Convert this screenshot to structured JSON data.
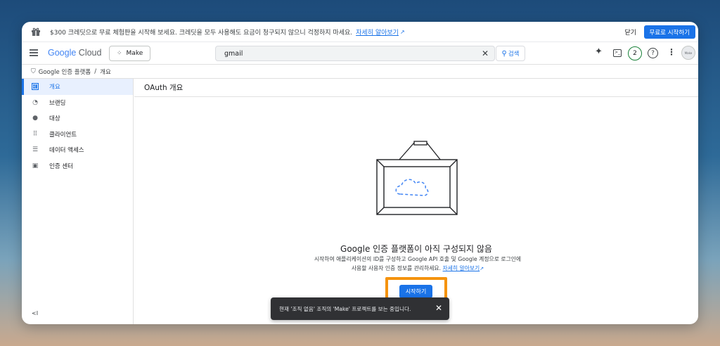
{
  "promo": {
    "text": "$300 크레딧으로 무료 체험판을 시작해 보세요. 크레딧을 모두 사용해도 요금이 청구되지 않으니 걱정하지 마세요.",
    "link": "자세히 알아보기",
    "close": "닫기",
    "trial_button": "무료로 시작하기"
  },
  "header": {
    "logo_google": "Google",
    "logo_cloud": "Cloud",
    "project": "Make",
    "search_value": "gmail",
    "search_button": "검색",
    "notification_count": "2",
    "avatar_text": "Make"
  },
  "breadcrumb": {
    "root": "Google 인증 플랫폼",
    "current": "개요"
  },
  "sidebar": {
    "items": [
      {
        "label": "개요",
        "icon": "dashboard-icon"
      },
      {
        "label": "브랜딩",
        "icon": "palette-icon"
      },
      {
        "label": "대상",
        "icon": "person-icon"
      },
      {
        "label": "클라이언트",
        "icon": "apps-icon"
      },
      {
        "label": "데이터 액세스",
        "icon": "list-settings-icon"
      },
      {
        "label": "인증 센터",
        "icon": "calendar-icon"
      }
    ],
    "collapse": "<I"
  },
  "main": {
    "title": "OAuth 개요",
    "empty_title": "Google 인증 플랫폼이 아직 구성되지 않음",
    "empty_desc": "시작하여 애플리케이션의 ID를 구성하고 Google API 호출 및 Google 계정으로 로그인에 사용할 사용자 인증 정보를 관리하세요.",
    "empty_link": "자세히 알아보기",
    "start_button": "시작하기"
  },
  "snackbar": {
    "text": "현재 '조직 없음' 조직의 'Make' 프로젝트를 보는 중입니다."
  },
  "colors": {
    "accent": "#1a73e8",
    "highlight": "#f5930e",
    "notification_ring": "#188038"
  }
}
